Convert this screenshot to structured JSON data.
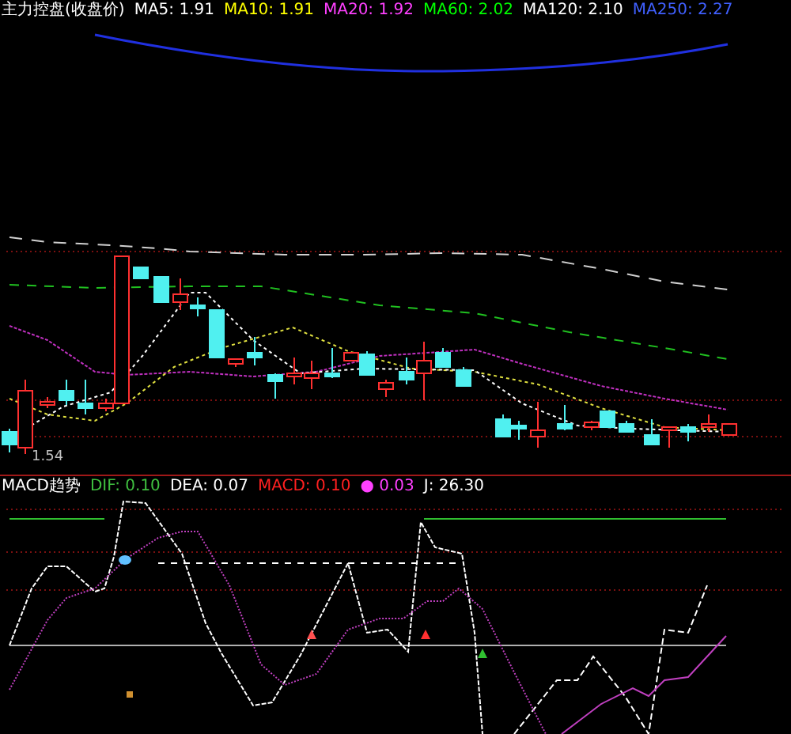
{
  "main_header": [
    {
      "text": "主力控盘(收盘价)",
      "color": "#ffffff"
    },
    {
      "text": "MA5: 1.91",
      "color": "#ffffff"
    },
    {
      "text": "MA10: 1.91",
      "color": "#ffff00"
    },
    {
      "text": "MA20: 1.92",
      "color": "#ff40ff"
    },
    {
      "text": "MA60: 2.02",
      "color": "#00ff00"
    },
    {
      "text": "MA120: 2.10",
      "color": "#ffffff"
    },
    {
      "text": "MA250: 2.27",
      "color": "#4060ff"
    }
  ],
  "low_label": "1.54",
  "indicator_header": [
    {
      "text": "MACD趋势",
      "color": "#ffffff"
    },
    {
      "text": "DIF: 0.10",
      "color": "#40c040"
    },
    {
      "text": "DEA: 0.07",
      "color": "#ffffff"
    },
    {
      "text": "MACD: 0.10",
      "color": "#ff2020"
    },
    {
      "text": "● 0.03",
      "color": "#ff40ff"
    },
    {
      "text": "J: 26.30",
      "color": "#ffffff"
    }
  ]
}
